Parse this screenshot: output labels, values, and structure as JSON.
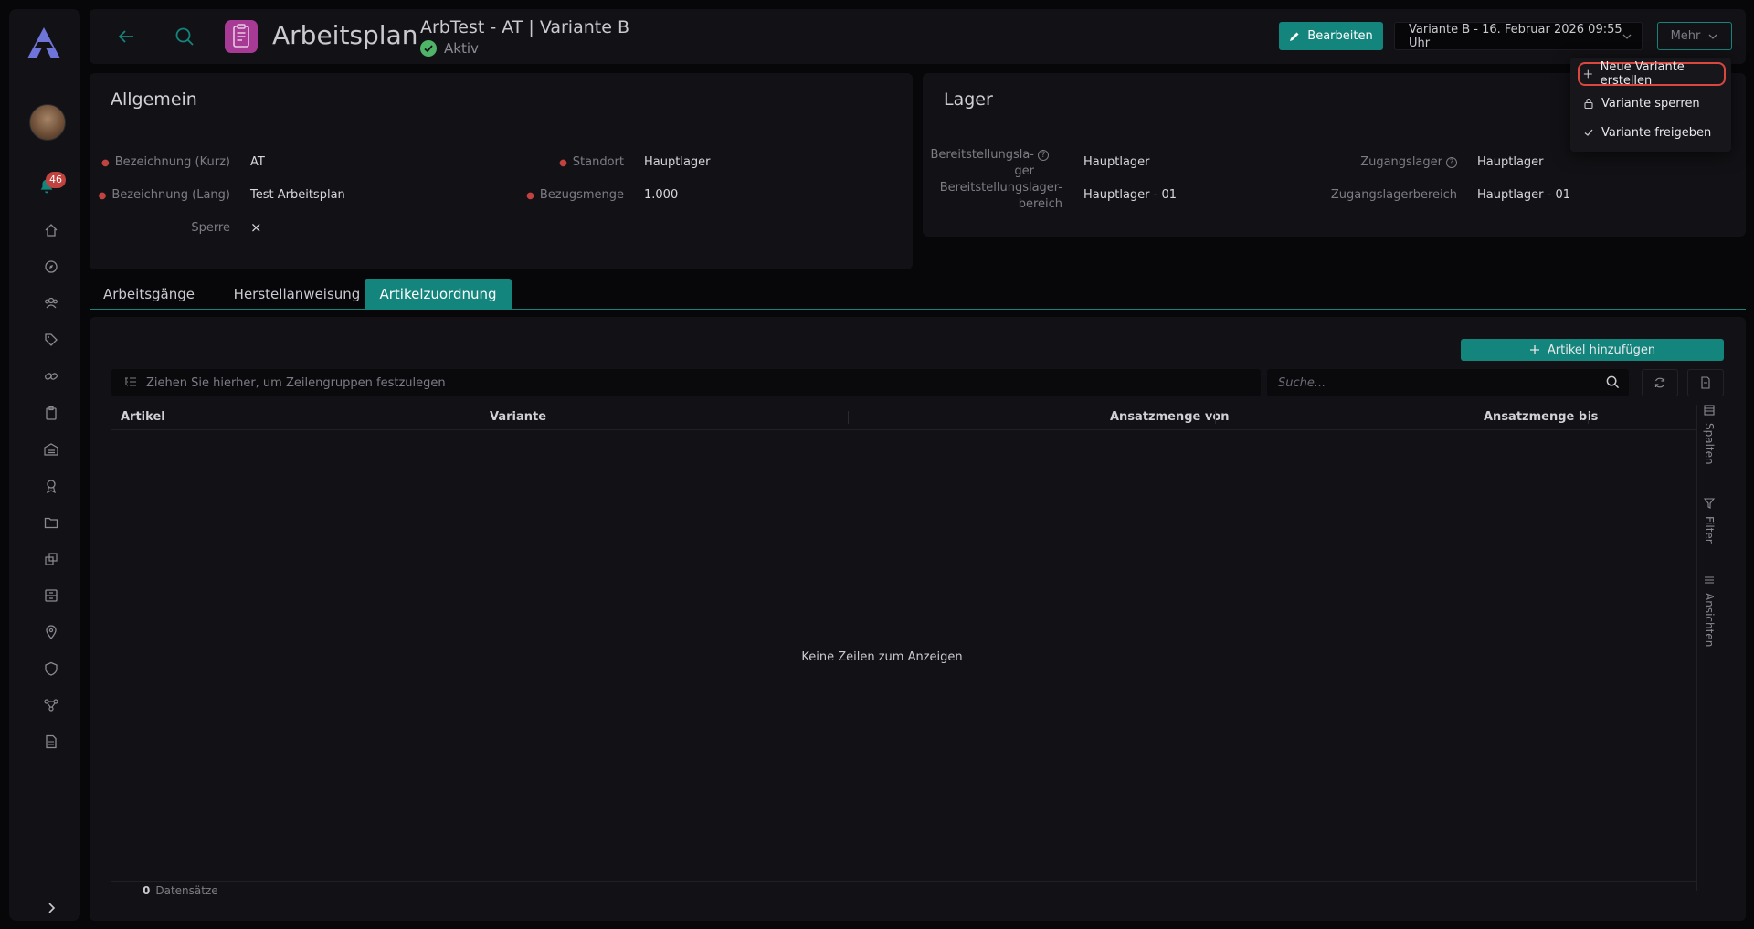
{
  "notifications": {
    "count": "46"
  },
  "header": {
    "title": "Arbeitsplan",
    "subtitle": "ArbTest - AT | Variante B",
    "status": "Aktiv",
    "edit_label": "Bearbeiten",
    "variant_select_value": "Variante B - 16. Februar 2026 09:55 Uhr",
    "more_label": "Mehr"
  },
  "more_menu": {
    "items": [
      {
        "label": "Neue Variante erstellen",
        "icon": "plus-icon"
      },
      {
        "label": "Variante sperren",
        "icon": "lock-icon"
      },
      {
        "label": "Variante freigeben",
        "icon": "check-icon"
      }
    ]
  },
  "general": {
    "title": "Allgemein",
    "fields": {
      "short_name_label": "Bezeichnung (Kurz)",
      "short_name_value": "AT",
      "long_name_label": "Bezeichnung (Lang)",
      "long_name_value": "Test Arbeitsplan",
      "lock_label": "Sperre",
      "lock_value": "×",
      "location_label": "Standort",
      "location_value": "Hauptlager",
      "ref_qty_label": "Bezugsmenge",
      "ref_qty_value": "1.000"
    }
  },
  "storage": {
    "title": "Lager",
    "fields": {
      "provision_label_1": "Bereitstellungsla-",
      "provision_label_2": "ger",
      "provision_value": "Hauptlager",
      "provision_area_label_1": "Bereitstellungslager-",
      "provision_area_label_2": "bereich",
      "provision_area_value": "Hauptlager - 01",
      "receipt_label": "Zugangslager",
      "receipt_value": "Hauptlager",
      "receipt_area_label": "Zugangslagerbereich",
      "receipt_area_value": "Hauptlager - 01"
    }
  },
  "tabs": [
    {
      "label": "Arbeitsgänge"
    },
    {
      "label": "Herstellanweisung"
    },
    {
      "label": "Artikelzuordnung"
    }
  ],
  "grid": {
    "add_label": "Artikel hinzufügen",
    "group_placeholder": "Ziehen Sie hierher, um Zeilengruppen festzulegen",
    "search_placeholder": "Suche...",
    "columns": [
      "Artikel",
      "Variante",
      "Ansatzmenge von",
      "Ansatzmenge bis"
    ],
    "empty_text": "Keine Zeilen zum Anzeigen",
    "side_tabs": [
      "Spalten",
      "Filter",
      "Ansichten"
    ],
    "record_count": "0",
    "record_label": "Datensätze"
  },
  "colors": {
    "accent": "#13857c",
    "app_icon": "#a63a94",
    "danger": "#c0433f",
    "ok": "#4fb368"
  }
}
